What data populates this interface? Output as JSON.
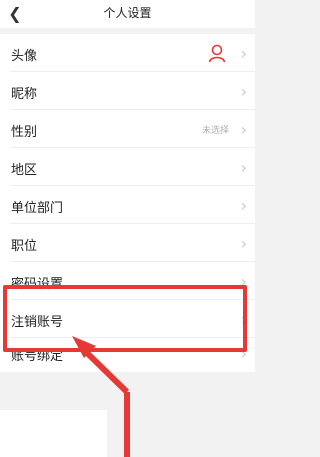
{
  "header": {
    "title": "个人设置",
    "back_icon": "chevron-left-icon"
  },
  "rows": [
    {
      "label": "头像",
      "value": "",
      "icon": "user-avatar-icon"
    },
    {
      "label": "昵称",
      "value": ""
    },
    {
      "label": "性别",
      "value": "未选择"
    },
    {
      "label": "地区",
      "value": ""
    },
    {
      "label": "单位部门",
      "value": ""
    },
    {
      "label": "职位",
      "value": ""
    },
    {
      "label": "密码设置",
      "value": ""
    },
    {
      "label": "注销账号",
      "value": ""
    },
    {
      "label": "账号绑定",
      "value": ""
    }
  ],
  "annotation": {
    "color": "#e53935",
    "highlight_target": "注销账号"
  }
}
